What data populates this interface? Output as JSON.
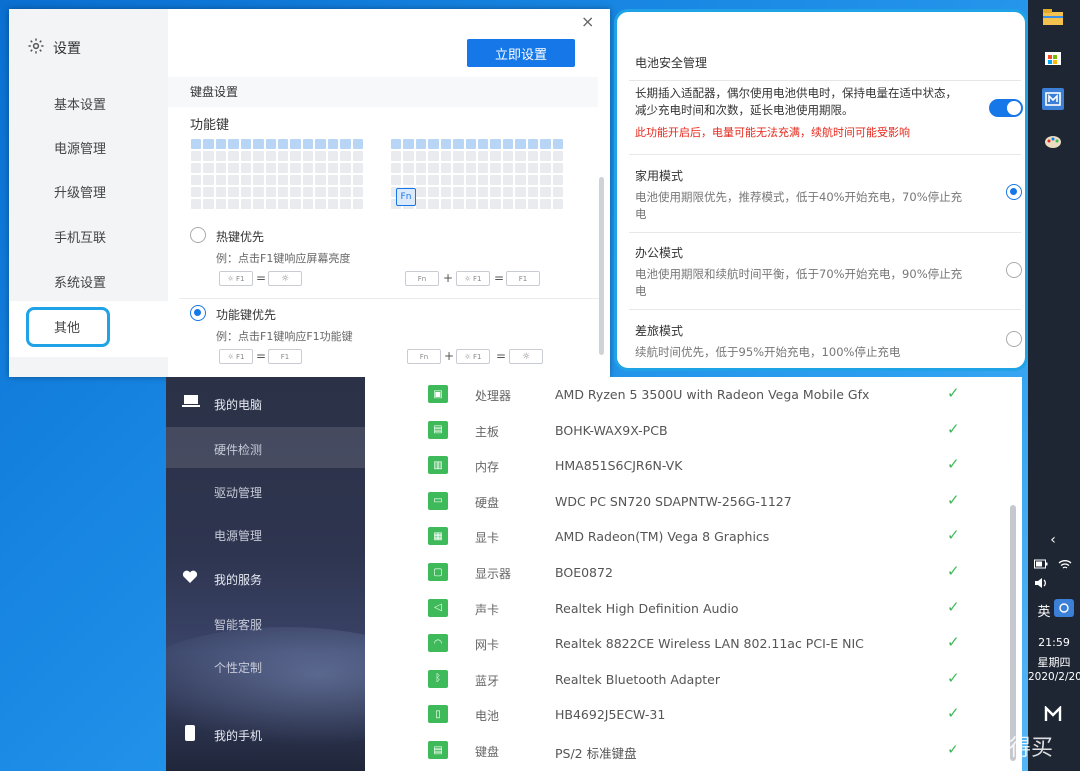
{
  "settings": {
    "title": "设置",
    "nav": [
      "基本设置",
      "电源管理",
      "升级管理",
      "手机互联",
      "系统设置",
      "其他"
    ],
    "close": "×",
    "apply_button": "立即设置",
    "keyboard_header": "键盘设置",
    "fn_title": "功能键",
    "fn_key": "Fn",
    "options": [
      {
        "label": "热键优先",
        "example": "例：点击F1键响应屏幕亮度",
        "selected": false
      },
      {
        "label": "功能键优先",
        "example": "例：点击F1键响应F1功能键",
        "selected": true
      }
    ],
    "keycaps": {
      "f1_small": "☼ F1",
      "sun": "☼",
      "f1": "F1",
      "fn": "Fn",
      "eq": "=",
      "plus": "+"
    }
  },
  "battery": {
    "title": "电池安全管理",
    "desc": "长期插入适配器，偶尔使用电池供电时，保持电量在适中状态，减少充电时间和次数，延长电池使用期限。",
    "warning": "此功能开启后，电量可能无法充满，续航时间可能受影响",
    "enabled": true,
    "modes": [
      {
        "name": "家用模式",
        "desc": "电池使用期限优先，推荐模式，低于40%开始充电，70%停止充电",
        "selected": true
      },
      {
        "name": "办公模式",
        "desc": "电池使用期限和续航时间平衡，低于70%开始充电，90%停止充电",
        "selected": false
      },
      {
        "name": "差旅模式",
        "desc": "续航时间优先，低于95%开始充电，100%停止充电",
        "selected": false
      }
    ]
  },
  "hardware": {
    "sidebar": {
      "my_pc": "我的电脑",
      "items": [
        "硬件检测",
        "驱动管理",
        "电源管理"
      ],
      "my_service": "我的服务",
      "service_items": [
        "智能客服",
        "个性定制"
      ],
      "my_phone": "我的手机"
    },
    "rows": [
      {
        "name": "处理器",
        "value": "AMD Ryzen 5 3500U with Radeon Vega Mobile Gfx"
      },
      {
        "name": "主板",
        "value": "BOHK-WAX9X-PCB"
      },
      {
        "name": "内存",
        "value": "HMA851S6CJR6N-VK"
      },
      {
        "name": "硬盘",
        "value": "WDC PC SN720 SDAPNTW-256G-1127"
      },
      {
        "name": "显卡",
        "value": "AMD Radeon(TM) Vega 8 Graphics"
      },
      {
        "name": "显示器",
        "value": "BOE0872"
      },
      {
        "name": "声卡",
        "value": "Realtek High Definition Audio"
      },
      {
        "name": "网卡",
        "value": "Realtek 8822CE Wireless LAN 802.11ac PCI-E NIC"
      },
      {
        "name": "蓝牙",
        "value": "Realtek Bluetooth Adapter"
      },
      {
        "name": "电池",
        "value": "HB4692J5ECW-31"
      },
      {
        "name": "键盘",
        "value": "PS/2 标准键盘"
      }
    ],
    "check": "✓"
  },
  "taskbar": {
    "lang": "英",
    "time": "21:59",
    "weekday": "星期四",
    "date": "2020/2/20"
  },
  "watermark": "值 什么值得买"
}
